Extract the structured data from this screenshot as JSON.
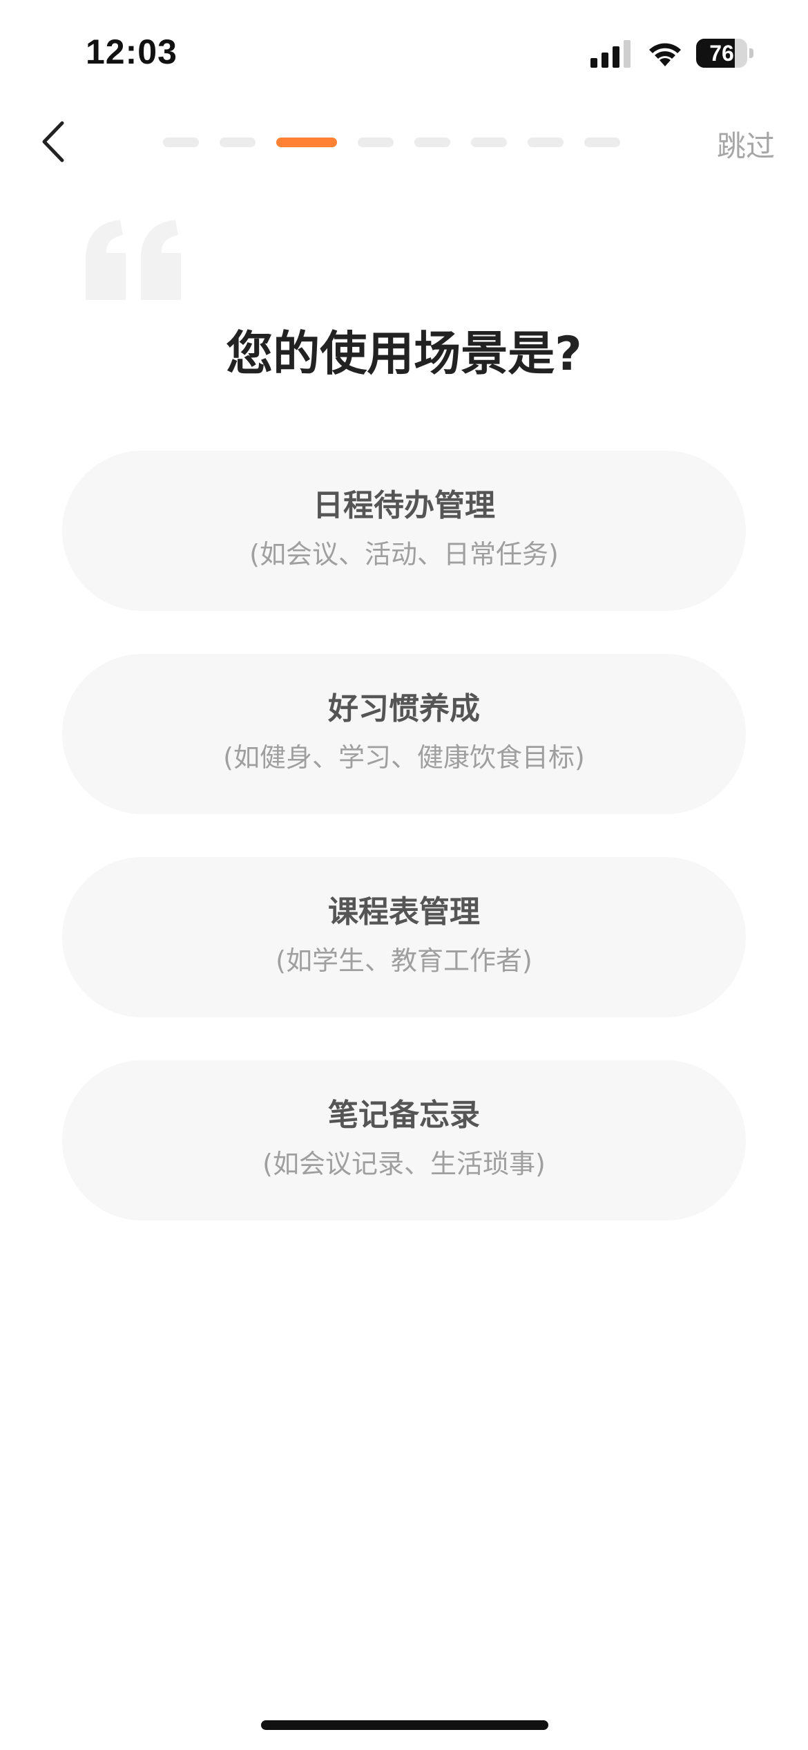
{
  "status_bar": {
    "time": "12:03",
    "battery_level": "76",
    "battery_fraction": 0.76,
    "icons": [
      "signal-icon",
      "wifi-icon",
      "battery-icon"
    ]
  },
  "nav": {
    "back_icon": "chevron-left-icon",
    "skip_label": "跳过",
    "progress": {
      "total_steps": 8,
      "current_step": 3
    }
  },
  "decor": {
    "icon": "quote-icon"
  },
  "question": {
    "title": "您的使用场景是?"
  },
  "options": [
    {
      "title": "日程待办管理",
      "subtitle": "(如会议、活动、日常任务)"
    },
    {
      "title": "好习惯养成",
      "subtitle": "(如健身、学习、健康饮食目标)"
    },
    {
      "title": "课程表管理",
      "subtitle": "(如学生、教育工作者)"
    },
    {
      "title": "笔记备忘录",
      "subtitle": "(如会议记录、生活琐事)"
    }
  ],
  "colors": {
    "accent": "#ff8133",
    "inactive_dash": "#ececec",
    "card_bg": "#f7f7f7",
    "title_text": "#222222",
    "option_title_text": "#555555",
    "option_subtitle_text": "#9f9f9f",
    "skip_text": "#a6a6a6"
  }
}
